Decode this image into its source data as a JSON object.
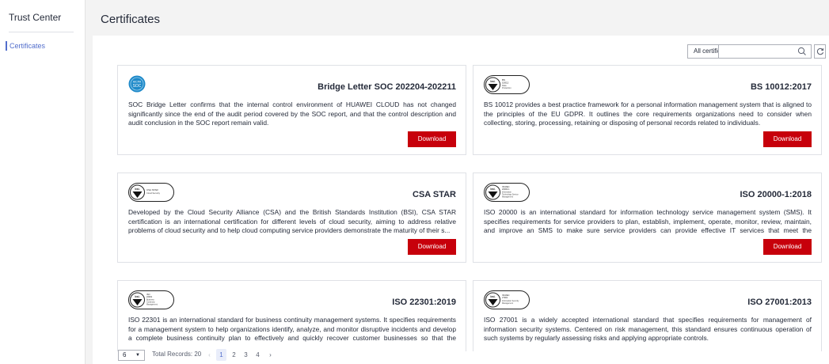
{
  "sidebar": {
    "title": "Trust Center",
    "items": [
      {
        "label": "Certificates"
      }
    ]
  },
  "header": {
    "title": "Certificates"
  },
  "toolbar": {
    "filter_value": "All certifications",
    "search_placeholder": ""
  },
  "cards": [
    {
      "title": "Bridge Letter SOC 202204-202211",
      "logo": "aicpa-soc-logo",
      "logo_text": [
        "AICPA",
        "SOC"
      ],
      "description": "SOC Bridge Letter confirms that the internal control environment of HUAWEI CLOUD has not changed significantly since the end of the audit period covered by the SOC report, and that the control description and audit conclusion in the SOC report remain valid.",
      "download_label": "Download"
    },
    {
      "title": "BS 10012:2017",
      "logo": "bsi-certification-logo",
      "logo_text": [
        "bsi.",
        "BS",
        "10012",
        "Data",
        "Protection"
      ],
      "description": "BS 10012 provides a best practice framework for a personal information management system that is aligned to the principles of the EU GDPR. It outlines the core requirements organizations need to consider when collecting, storing, processing, retaining or disposing of personal records related to individuals.",
      "download_label": "Download"
    },
    {
      "title": "CSA STAR",
      "logo": "bsi-certification-logo",
      "logo_text": [
        "bsi.",
        "CSA STAR",
        "Cloud Security"
      ],
      "description": "Developed by the Cloud Security Alliance (CSA) and the British Standards Institution (BSI), CSA STAR certification is an international certification for different levels of cloud security, aiming to address relative problems of cloud security and to help cloud computing service providers demonstrate the maturity of their s...",
      "download_label": "Download"
    },
    {
      "title": "ISO 20000-1:2018",
      "logo": "bsi-certification-logo",
      "logo_text": [
        "bsi.",
        "ISO/IEC",
        "20000-1",
        "Information",
        "Technology Service",
        "Management"
      ],
      "description": "ISO 20000 is an international standard for information technology service management system (SMS). It specifies requirements for service providers to plan, establish, implement, operate, monitor, review, maintain, and improve an SMS to make sure service providers can provide effective IT services that meet the requireme...",
      "download_label": "Download"
    },
    {
      "title": "ISO 22301:2019",
      "logo": "bsi-certification-logo",
      "logo_text": [
        "bsi.",
        "ISO",
        "22301",
        "Business",
        "Continuity",
        "Management"
      ],
      "description": "ISO 22301 is an international standard for business continuity management systems. It specifies requirements for a management system to help organizations identify, analyze, and monitor disruptive incidents and develop a complete business continuity plan to effectively and quickly recover customer businesses so that the organiz...",
      "download_label": ""
    },
    {
      "title": "ISO 27001:2013",
      "logo": "bsi-certification-logo",
      "logo_text": [
        "bsi.",
        "ISO/IEC",
        "27001",
        "Information Security",
        "Management"
      ],
      "description": "ISO 27001 is a widely accepted international standard that specifies requirements for management of information security systems. Centered on risk management, this standard ensures continuous operation of such systems by regularly assessing risks and applying appropriate controls.",
      "download_label": ""
    }
  ],
  "pagination": {
    "page_size": "6",
    "total_label": "Total Records: 20",
    "prev": "‹",
    "next": "›",
    "pages": [
      "1",
      "2",
      "3",
      "4"
    ],
    "current_page": "1"
  },
  "colors": {
    "accent": "#526ecc",
    "download_button": "#c7000b",
    "page_background": "#f3f3f3"
  }
}
